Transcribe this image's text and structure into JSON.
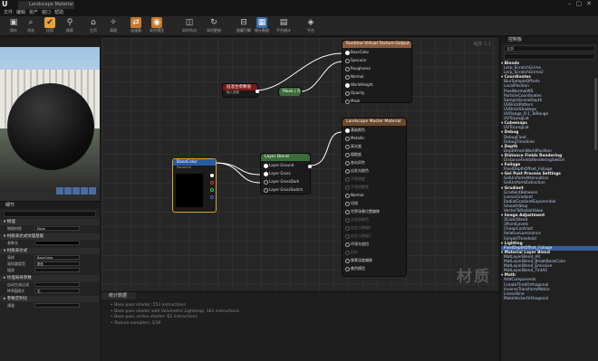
{
  "window": {
    "tab_title": "Landscape Material",
    "menu": [
      "文件",
      "编辑",
      "资产",
      "窗口",
      "帮助"
    ]
  },
  "toolbar": [
    {
      "icon": "save-icon",
      "label": "保存",
      "glyph": "▣"
    },
    {
      "icon": "browse-icon",
      "label": "浏览",
      "glyph": "⌕"
    },
    {
      "icon": "apply-icon",
      "label": "应用",
      "glyph": "✔"
    },
    {
      "icon": "search-icon",
      "label": "搜索",
      "glyph": "⚲"
    },
    {
      "icon": "home-icon",
      "label": "主页",
      "glyph": "⌂"
    },
    {
      "icon": "clean-icon",
      "label": "清理",
      "glyph": "✧"
    },
    {
      "icon": "connectors-icon",
      "label": "连接器",
      "glyph": "⇄"
    },
    {
      "icon": "live-preview-icon",
      "label": "实时预览",
      "glyph": "◉"
    },
    {
      "icon": "live-nodes-icon",
      "label": "实时节点",
      "glyph": "◫"
    },
    {
      "icon": "live-update-icon",
      "label": "实时更新",
      "glyph": "↻"
    },
    {
      "icon": "hide-pins-icon",
      "label": "隐藏引脚",
      "glyph": "⊟"
    },
    {
      "icon": "stats-icon",
      "label": "统计数据",
      "glyph": "▦"
    },
    {
      "icon": "mobile-stats-icon",
      "label": "平台统计",
      "glyph": "▤"
    },
    {
      "icon": "platform-icon",
      "label": "平台",
      "glyph": "◈"
    }
  ],
  "viewport": {
    "toolbar_hint": "视口"
  },
  "details": {
    "tab": "细节",
    "sections": [
      {
        "title": "▾ 物理",
        "rows": [
          {
            "label": "物理材质",
            "value": "None"
          }
        ]
      },
      {
        "title": "▾ 材质表达式纹理基础",
        "rows": [
          {
            "label": "参数名",
            "value": "",
            "black": true
          }
        ]
      },
      {
        "title": "▾ 材质表达式",
        "rows": [
          {
            "label": "采样",
            "value": "BaseColor"
          },
          {
            "label": "采样器类型",
            "value": "颜色"
          },
          {
            "label": "描述",
            "value": ""
          }
        ]
      },
      {
        "title": "▸ 纹理采样参数",
        "rows": [
          {
            "label": "自动生成过滤",
            "value": ""
          },
          {
            "label": "MIP值模式",
            "value": "无"
          }
        ]
      },
      {
        "title": "▸ 参数定制化",
        "rows": [
          {
            "label": "通道",
            "value": ""
          }
        ]
      }
    ]
  },
  "graph": {
    "zoom_label": "缩放 1:1",
    "watermark": "材质",
    "nodes": {
      "rvt": {
        "title": "Runtime Virtual Texture Output",
        "pins": [
          "BaseColor",
          "Specular",
          "Roughness",
          "Normal",
          "WorldHeight",
          "Opacity",
          "Mask"
        ]
      },
      "param": {
        "title": "层混合参数值",
        "subtitle": "输入参数"
      },
      "mask": {
        "title": "Mask ( R )"
      },
      "layer": {
        "title": "Layer Blend",
        "pins": [
          "Layer Ground",
          "Layer Grass",
          "Layer GrassDark",
          "Layer GrassSwitch"
        ]
      },
      "sample": {
        "title": "BaseColor",
        "subtitle": "Param2D"
      },
      "main": {
        "title": "Landscape Master Material",
        "pins": [
          {
            "label": "基础颜色",
            "on": true
          },
          {
            "label": "Metallic",
            "on": false
          },
          {
            "label": "高光度",
            "on": false
          },
          {
            "label": "粗糙度",
            "on": false
          },
          {
            "label": "各向异性",
            "on": false
          },
          {
            "label": "自发光颜色",
            "on": false
          },
          {
            "label": "不透明度",
            "on": false,
            "dim": true
          },
          {
            "label": "不透明蒙版",
            "on": false,
            "dim": true
          },
          {
            "label": "Normal",
            "on": false
          },
          {
            "label": "切线",
            "on": false
          },
          {
            "label": "世界场景位置偏移",
            "on": false
          },
          {
            "label": "次表面颜色",
            "on": false,
            "dim": true
          },
          {
            "label": "自定义数据0",
            "on": false,
            "dim": true
          },
          {
            "label": "自定义数据1",
            "on": false,
            "dim": true
          },
          {
            "label": "环境光遮挡",
            "on": false
          },
          {
            "label": "折射",
            "on": false,
            "dim": true
          },
          {
            "label": "像素深度偏移",
            "on": false
          },
          {
            "label": "着色模型",
            "on": false
          }
        ]
      }
    }
  },
  "stats": {
    "tab": "统计数据",
    "lines": [
      "• Base pass shader: 153 instructions",
      "• Base pass shader with Volumetric Lightmap: 161 instructions",
      "• Base pass vertex shader: 62 instructions",
      "• Texture samplers: 3/16"
    ]
  },
  "palette": {
    "tab": "控制板",
    "category": "全部",
    "items": [
      {
        "t": "▾ Blends",
        "cat": true
      },
      {
        "t": "Lerp_ScratchGrime"
      },
      {
        "t": "Lerp_ScratchGrime2"
      },
      {
        "t": "▾ Coordinates",
        "cat": true
      },
      {
        "t": "BlurSampleOffsets"
      },
      {
        "t": "LocalPosition"
      },
      {
        "t": "PixelNormalWS"
      },
      {
        "t": "ParticleCoordinates"
      },
      {
        "t": "SampleSceneDepth"
      },
      {
        "t": "UVBrickPattern"
      },
      {
        "t": "UVBrickShadows"
      },
      {
        "t": "UVRange_0-1_ToRange"
      },
      {
        "t": "UVToLongLat"
      },
      {
        "t": "▾ Cubemaps",
        "cat": true
      },
      {
        "t": "UVToLongLat"
      },
      {
        "t": "▾ Debug",
        "cat": true
      },
      {
        "t": "DebugFloat"
      },
      {
        "t": "DebugTimeSine"
      },
      {
        "t": "▾ Depth",
        "cat": true
      },
      {
        "t": "DepthFromWorldPosition"
      },
      {
        "t": "▾ Distance Fields Rendering",
        "cat": true
      },
      {
        "t": "DistanceFieldsRenderingSwitch"
      },
      {
        "t": "▾ Foliage",
        "cat": true
      },
      {
        "t": "PixelDepthOffset_Foliage"
      },
      {
        "t": "▾ Gel Post Process Settings",
        "cat": true
      },
      {
        "t": "GelUniformAttenuation"
      },
      {
        "t": "GelUniformExtinction"
      },
      {
        "t": "▾ Gradient",
        "cat": true
      },
      {
        "t": "GradientBetween"
      },
      {
        "t": "LinearGradient"
      },
      {
        "t": "RadialGradientExponential"
      },
      {
        "t": "SmoothStep"
      },
      {
        "t": "VectorToRadialValue"
      },
      {
        "t": "▾ Image Adjustment",
        "cat": true
      },
      {
        "t": "3ColorBlend"
      },
      {
        "t": "3PointLevels"
      },
      {
        "t": "CheapContrast"
      },
      {
        "t": "RelativeLuminance"
      },
      {
        "t": "SimpleThreshold"
      },
      {
        "t": "▾ Lighting",
        "cat": true
      },
      {
        "t": "PixelDepthOffset_Foliage",
        "sel": true
      },
      {
        "t": "▾ Material Layer Blend",
        "cat": true
      },
      {
        "t": "MatLayerBlend_Alt"
      },
      {
        "t": "MatLayerBlend_BreakBaseColor"
      },
      {
        "t": "MatLayerBlend_Emissive"
      },
      {
        "t": "MatLayerBlend_TintAll"
      },
      {
        "t": "▾ Math",
        "cat": true
      },
      {
        "t": "AddComponents"
      },
      {
        "t": "CreateThirdOrthogonal"
      },
      {
        "t": "InverseTransformMatrix"
      },
      {
        "t": "LinearSine"
      },
      {
        "t": "MakeVectorOrthogonal"
      }
    ]
  }
}
